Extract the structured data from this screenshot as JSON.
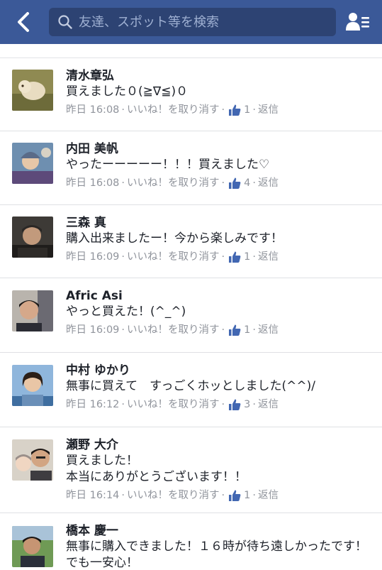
{
  "header": {
    "search_placeholder": "友達、スポット等を検索",
    "brand_color": "#3b5998",
    "back_icon": "chevron-left-icon",
    "search_icon": "search-icon",
    "friends_icon": "friends-list-icon"
  },
  "comments": [
    {
      "name": "清水章弘",
      "text": "買えました０(≧∇≦)０",
      "time": "昨日 16:08",
      "unlike": "いいね！を取り消す",
      "likes": "1",
      "reply": "返信"
    },
    {
      "name": "内田 美帆",
      "text": "やったーーーーー！！！買えました♡",
      "time": "昨日 16:08",
      "unlike": "いいね！を取り消す",
      "likes": "4",
      "reply": "返信"
    },
    {
      "name": "三森 真",
      "text": "購入出来ましたー！今から楽しみです！",
      "time": "昨日 16:09",
      "unlike": "いいね！を取り消す",
      "likes": "1",
      "reply": "返信"
    },
    {
      "name": "Afric Asi",
      "text": "やっと買えた！(^_^)",
      "time": "昨日 16:09",
      "unlike": "いいね！を取り消す",
      "likes": "1",
      "reply": "返信"
    },
    {
      "name": "中村 ゆかり",
      "text": "無事に買えて　すっごくホッとしました(^^)/",
      "time": "昨日 16:12",
      "unlike": "いいね！を取り消す",
      "likes": "3",
      "reply": "返信"
    },
    {
      "name": "瀬野 大介",
      "text": "買えました！\n本当にありがとうございます！！",
      "time": "昨日 16:14",
      "unlike": "いいね！を取り消す",
      "likes": "1",
      "reply": "返信"
    },
    {
      "name": "橋本 慶一",
      "text": "無事に購入できました！１６時が待ち遠しかったです！でも一安心！",
      "time": "",
      "unlike": "",
      "likes": "",
      "reply": ""
    }
  ]
}
